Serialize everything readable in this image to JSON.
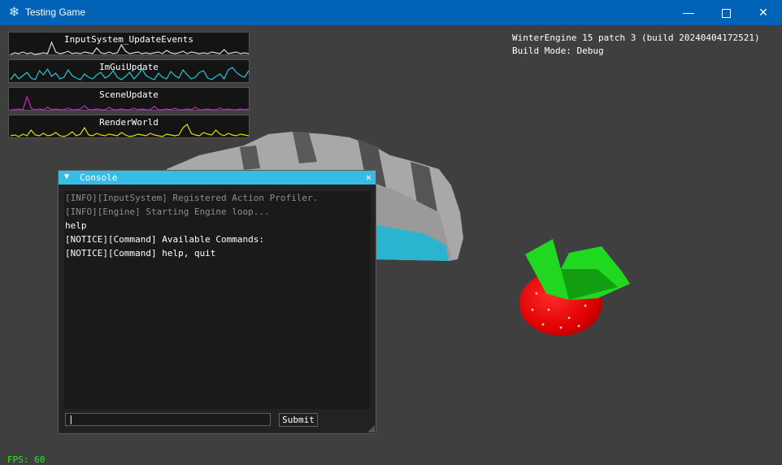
{
  "window": {
    "title": "Testing Game",
    "app_icon": "snowflake-icon",
    "min_icon": "minimize-icon",
    "max_icon": "maximize-icon",
    "close_icon": "close-icon",
    "min_glyph": "—",
    "close_glyph": "✕"
  },
  "profilers": [
    {
      "name": "InputSystem_UpdateEvents",
      "color": "#d8d8d8"
    },
    {
      "name": "ImGuiUpdate",
      "color": "#20c8d8"
    },
    {
      "name": "SceneUpdate",
      "color": "#d020d0"
    },
    {
      "name": "RenderWorld",
      "color": "#e0e000"
    }
  ],
  "engine_info": {
    "line1": "WinterEngine 15 patch 3 (build 20240404172521)",
    "line2": "Build Mode: Debug"
  },
  "console": {
    "title": "Console",
    "collapse_glyph": "▼",
    "close_glyph": "✕",
    "log": [
      {
        "text": "[INFO][InputSystem] Registered Action Profiler.",
        "dim": true
      },
      {
        "text": "[INFO][Engine] Starting Engine loop...",
        "dim": true
      },
      {
        "text": "help",
        "dim": false
      },
      {
        "text": "[NOTICE][Command] Available Commands:",
        "dim": false
      },
      {
        "text": "[NOTICE][Command] help, quit",
        "dim": false
      }
    ],
    "input_value": "|",
    "submit_label": "Submit"
  },
  "status": {
    "fps": "FPS: 60"
  }
}
